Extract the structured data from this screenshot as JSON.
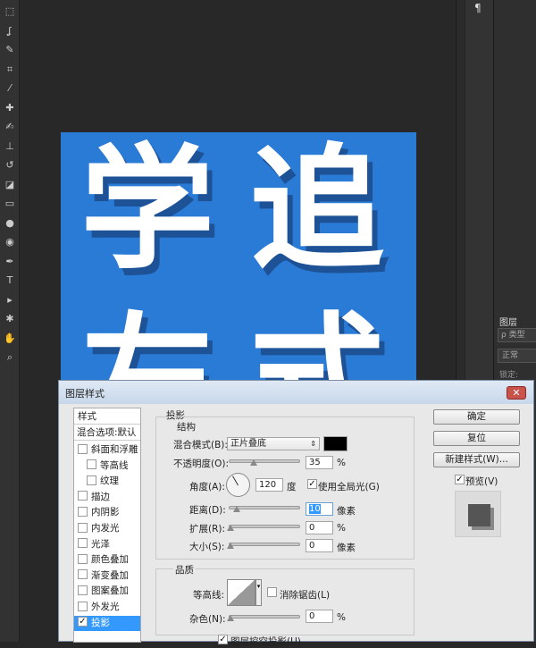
{
  "toolbar": {
    "tools": [
      "marquee-icon",
      "lasso-icon",
      "quick-select-icon",
      "crop-icon",
      "eyedropper-icon",
      "healing-icon",
      "brush-icon",
      "stamp-icon",
      "history-brush-icon",
      "eraser-icon",
      "gradient-icon",
      "blur-icon",
      "dodge-icon",
      "pen-icon",
      "type-icon",
      "path-select-icon",
      "shape-icon",
      "hand-icon",
      "zoom-icon"
    ]
  },
  "canvas": {
    "chars": [
      "学",
      "追",
      "左",
      "式"
    ],
    "bg": "#2a7bd6"
  },
  "right_panel": {
    "paragraph_icon": "¶",
    "layers_tab": "图层",
    "search_placeholder": "ρ 类型",
    "blend_mode": "正常",
    "lock_label": "锁定:"
  },
  "dialog": {
    "title": "图层样式",
    "close": "✕",
    "styles_header": "样式",
    "blend_options": "混合选项:默认",
    "items": [
      {
        "label": "斜面和浮雕",
        "checked": false,
        "indent": false
      },
      {
        "label": "等高线",
        "checked": false,
        "indent": true
      },
      {
        "label": "纹理",
        "checked": false,
        "indent": true
      },
      {
        "label": "描边",
        "checked": false,
        "indent": false
      },
      {
        "label": "内阴影",
        "checked": false,
        "indent": false
      },
      {
        "label": "内发光",
        "checked": false,
        "indent": false
      },
      {
        "label": "光泽",
        "checked": false,
        "indent": false
      },
      {
        "label": "颜色叠加",
        "checked": false,
        "indent": false
      },
      {
        "label": "渐变叠加",
        "checked": false,
        "indent": false
      },
      {
        "label": "图案叠加",
        "checked": false,
        "indent": false
      },
      {
        "label": "外发光",
        "checked": false,
        "indent": false
      },
      {
        "label": "投影",
        "checked": true,
        "indent": false,
        "selected": true
      }
    ],
    "section_title": "投影",
    "structure": {
      "title": "结构",
      "blend_mode_label": "混合模式(B):",
      "blend_mode_value": "正片叠底",
      "shadow_color": "#000000",
      "opacity_label": "不透明度(O):",
      "opacity_value": "35",
      "opacity_unit": "%",
      "angle_label": "角度(A):",
      "angle_value": "120",
      "angle_unit": "度",
      "global_light_label": "使用全局光(G)",
      "global_light_checked": true,
      "distance_label": "距离(D):",
      "distance_value": "10",
      "distance_unit": "像素",
      "spread_label": "扩展(R):",
      "spread_value": "0",
      "spread_unit": "%",
      "size_label": "大小(S):",
      "size_value": "0",
      "size_unit": "像素"
    },
    "quality": {
      "title": "品质",
      "contour_label": "等高线:",
      "antialias_label": "消除锯齿(L)",
      "antialias_checked": false,
      "noise_label": "杂色(N):",
      "noise_value": "0",
      "noise_unit": "%",
      "knockout_label": "图层挖空投影(U)",
      "knockout_checked": true
    },
    "buttons": {
      "ok": "确定",
      "reset": "复位",
      "new_style": "新建样式(W)...",
      "preview_label": "预览(V)",
      "preview_checked": true
    }
  }
}
